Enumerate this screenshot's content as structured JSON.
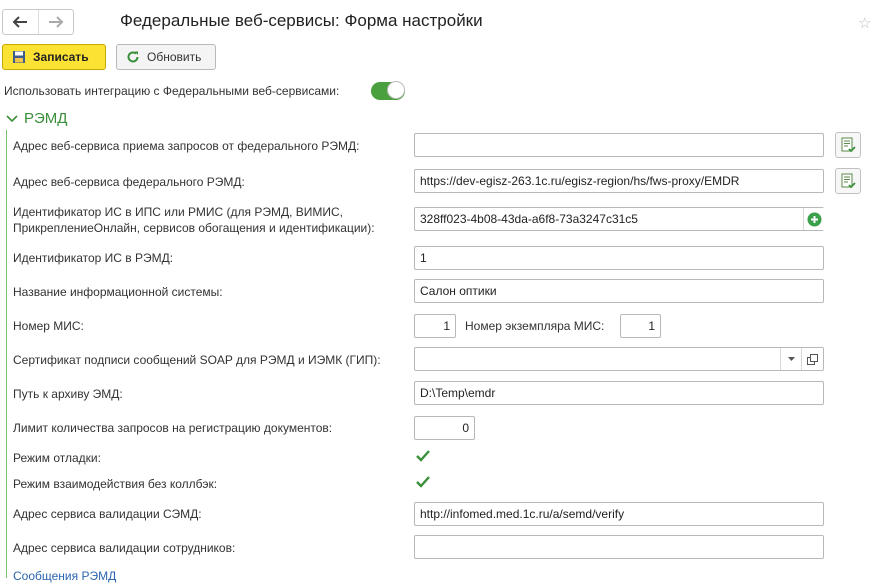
{
  "header": {
    "title": "Федеральные веб-сервисы: Форма настройки"
  },
  "toolbar": {
    "save_label": "Записать",
    "refresh_label": "Обновить"
  },
  "integration": {
    "label": "Использовать интеграцию с Федеральными веб-сервисами:",
    "enabled": true
  },
  "section": {
    "title": "РЭМД",
    "expanded": true
  },
  "fields": {
    "request_service_address": {
      "label": "Адрес веб-сервиса приема запросов от федерального РЭМД:",
      "value": ""
    },
    "federal_service_address": {
      "label": "Адрес веб-сервиса федерального РЭМД:",
      "value": "https://dev-egisz-263.1c.ru/egisz-region/hs/fws-proxy/EMDR"
    },
    "is_identifier_ips": {
      "label_line1": "Идентификатор ИС в ИПС или РМИС (для РЭМД, ВИМИС,",
      "label_line2": "ПрикреплениеОнлайн, сервисов обогащения и идентификации):",
      "value": "328ff023-4b08-43da-a6f8-73a3247c31c5"
    },
    "is_identifier_remd": {
      "label": "Идентификатор ИС в РЭМД:",
      "value": "1"
    },
    "system_name": {
      "label": "Название информационной системы:",
      "value": "Салон оптики"
    },
    "mis_number": {
      "label": "Номер МИС:",
      "value": "1"
    },
    "mis_instance_number": {
      "label": "Номер экземпляра МИС:",
      "value": "1"
    },
    "soap_certificate": {
      "label": "Сертификат подписи сообщений SOAP для РЭМД и ИЭМК (ГИП):",
      "value": ""
    },
    "emd_archive_path": {
      "label": "Путь к архиву ЭМД:",
      "value": "D:\\Temp\\emdr"
    },
    "request_limit": {
      "label": "Лимит количества запросов на регистрацию документов:",
      "value": "0"
    },
    "debug_mode": {
      "label": "Режим отладки:",
      "checked": true
    },
    "no_callback_mode": {
      "label": "Режим взаимодействия без коллбэк:",
      "checked": true
    },
    "semd_validation_address": {
      "label": "Адрес сервиса валидации СЭМД:",
      "value": "http://infomed.med.1c.ru/a/semd/verify"
    },
    "employee_validation_address": {
      "label": "Адрес сервиса валидации сотрудников:",
      "value": ""
    }
  },
  "footer_link": "Сообщения РЭМД",
  "colors": {
    "primary_button": "#fbe233",
    "accent_green": "#3a8f3a",
    "toggle_on": "#4a9f3e",
    "link": "#2b65b0"
  }
}
